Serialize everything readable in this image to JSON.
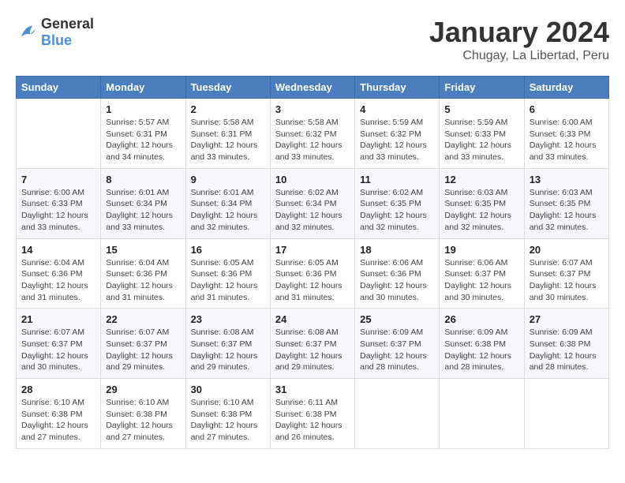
{
  "logo": {
    "general": "General",
    "blue": "Blue"
  },
  "title": "January 2024",
  "subtitle": "Chugay, La Libertad, Peru",
  "days_of_week": [
    "Sunday",
    "Monday",
    "Tuesday",
    "Wednesday",
    "Thursday",
    "Friday",
    "Saturday"
  ],
  "weeks": [
    [
      {
        "num": "",
        "sunrise": "",
        "sunset": "",
        "daylight": ""
      },
      {
        "num": "1",
        "sunrise": "Sunrise: 5:57 AM",
        "sunset": "Sunset: 6:31 PM",
        "daylight": "Daylight: 12 hours and 34 minutes."
      },
      {
        "num": "2",
        "sunrise": "Sunrise: 5:58 AM",
        "sunset": "Sunset: 6:31 PM",
        "daylight": "Daylight: 12 hours and 33 minutes."
      },
      {
        "num": "3",
        "sunrise": "Sunrise: 5:58 AM",
        "sunset": "Sunset: 6:32 PM",
        "daylight": "Daylight: 12 hours and 33 minutes."
      },
      {
        "num": "4",
        "sunrise": "Sunrise: 5:59 AM",
        "sunset": "Sunset: 6:32 PM",
        "daylight": "Daylight: 12 hours and 33 minutes."
      },
      {
        "num": "5",
        "sunrise": "Sunrise: 5:59 AM",
        "sunset": "Sunset: 6:33 PM",
        "daylight": "Daylight: 12 hours and 33 minutes."
      },
      {
        "num": "6",
        "sunrise": "Sunrise: 6:00 AM",
        "sunset": "Sunset: 6:33 PM",
        "daylight": "Daylight: 12 hours and 33 minutes."
      }
    ],
    [
      {
        "num": "7",
        "sunrise": "Sunrise: 6:00 AM",
        "sunset": "Sunset: 6:33 PM",
        "daylight": "Daylight: 12 hours and 33 minutes."
      },
      {
        "num": "8",
        "sunrise": "Sunrise: 6:01 AM",
        "sunset": "Sunset: 6:34 PM",
        "daylight": "Daylight: 12 hours and 33 minutes."
      },
      {
        "num": "9",
        "sunrise": "Sunrise: 6:01 AM",
        "sunset": "Sunset: 6:34 PM",
        "daylight": "Daylight: 12 hours and 32 minutes."
      },
      {
        "num": "10",
        "sunrise": "Sunrise: 6:02 AM",
        "sunset": "Sunset: 6:34 PM",
        "daylight": "Daylight: 12 hours and 32 minutes."
      },
      {
        "num": "11",
        "sunrise": "Sunrise: 6:02 AM",
        "sunset": "Sunset: 6:35 PM",
        "daylight": "Daylight: 12 hours and 32 minutes."
      },
      {
        "num": "12",
        "sunrise": "Sunrise: 6:03 AM",
        "sunset": "Sunset: 6:35 PM",
        "daylight": "Daylight: 12 hours and 32 minutes."
      },
      {
        "num": "13",
        "sunrise": "Sunrise: 6:03 AM",
        "sunset": "Sunset: 6:35 PM",
        "daylight": "Daylight: 12 hours and 32 minutes."
      }
    ],
    [
      {
        "num": "14",
        "sunrise": "Sunrise: 6:04 AM",
        "sunset": "Sunset: 6:36 PM",
        "daylight": "Daylight: 12 hours and 31 minutes."
      },
      {
        "num": "15",
        "sunrise": "Sunrise: 6:04 AM",
        "sunset": "Sunset: 6:36 PM",
        "daylight": "Daylight: 12 hours and 31 minutes."
      },
      {
        "num": "16",
        "sunrise": "Sunrise: 6:05 AM",
        "sunset": "Sunset: 6:36 PM",
        "daylight": "Daylight: 12 hours and 31 minutes."
      },
      {
        "num": "17",
        "sunrise": "Sunrise: 6:05 AM",
        "sunset": "Sunset: 6:36 PM",
        "daylight": "Daylight: 12 hours and 31 minutes."
      },
      {
        "num": "18",
        "sunrise": "Sunrise: 6:06 AM",
        "sunset": "Sunset: 6:36 PM",
        "daylight": "Daylight: 12 hours and 30 minutes."
      },
      {
        "num": "19",
        "sunrise": "Sunrise: 6:06 AM",
        "sunset": "Sunset: 6:37 PM",
        "daylight": "Daylight: 12 hours and 30 minutes."
      },
      {
        "num": "20",
        "sunrise": "Sunrise: 6:07 AM",
        "sunset": "Sunset: 6:37 PM",
        "daylight": "Daylight: 12 hours and 30 minutes."
      }
    ],
    [
      {
        "num": "21",
        "sunrise": "Sunrise: 6:07 AM",
        "sunset": "Sunset: 6:37 PM",
        "daylight": "Daylight: 12 hours and 30 minutes."
      },
      {
        "num": "22",
        "sunrise": "Sunrise: 6:07 AM",
        "sunset": "Sunset: 6:37 PM",
        "daylight": "Daylight: 12 hours and 29 minutes."
      },
      {
        "num": "23",
        "sunrise": "Sunrise: 6:08 AM",
        "sunset": "Sunset: 6:37 PM",
        "daylight": "Daylight: 12 hours and 29 minutes."
      },
      {
        "num": "24",
        "sunrise": "Sunrise: 6:08 AM",
        "sunset": "Sunset: 6:37 PM",
        "daylight": "Daylight: 12 hours and 29 minutes."
      },
      {
        "num": "25",
        "sunrise": "Sunrise: 6:09 AM",
        "sunset": "Sunset: 6:37 PM",
        "daylight": "Daylight: 12 hours and 28 minutes."
      },
      {
        "num": "26",
        "sunrise": "Sunrise: 6:09 AM",
        "sunset": "Sunset: 6:38 PM",
        "daylight": "Daylight: 12 hours and 28 minutes."
      },
      {
        "num": "27",
        "sunrise": "Sunrise: 6:09 AM",
        "sunset": "Sunset: 6:38 PM",
        "daylight": "Daylight: 12 hours and 28 minutes."
      }
    ],
    [
      {
        "num": "28",
        "sunrise": "Sunrise: 6:10 AM",
        "sunset": "Sunset: 6:38 PM",
        "daylight": "Daylight: 12 hours and 27 minutes."
      },
      {
        "num": "29",
        "sunrise": "Sunrise: 6:10 AM",
        "sunset": "Sunset: 6:38 PM",
        "daylight": "Daylight: 12 hours and 27 minutes."
      },
      {
        "num": "30",
        "sunrise": "Sunrise: 6:10 AM",
        "sunset": "Sunset: 6:38 PM",
        "daylight": "Daylight: 12 hours and 27 minutes."
      },
      {
        "num": "31",
        "sunrise": "Sunrise: 6:11 AM",
        "sunset": "Sunset: 6:38 PM",
        "daylight": "Daylight: 12 hours and 26 minutes."
      },
      {
        "num": "",
        "sunrise": "",
        "sunset": "",
        "daylight": ""
      },
      {
        "num": "",
        "sunrise": "",
        "sunset": "",
        "daylight": ""
      },
      {
        "num": "",
        "sunrise": "",
        "sunset": "",
        "daylight": ""
      }
    ]
  ]
}
